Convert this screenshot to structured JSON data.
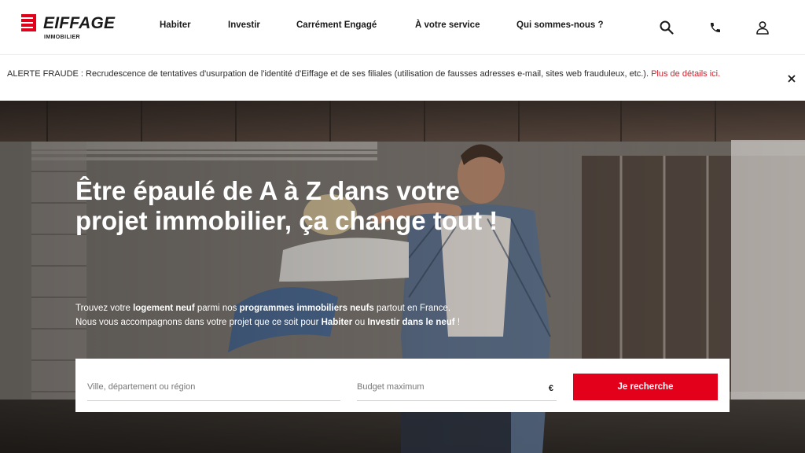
{
  "brand": {
    "name": "EIFFAGE",
    "subtitle": "IMMOBILIER",
    "color": "#e3001b"
  },
  "nav": {
    "items": [
      {
        "label": "Habiter"
      },
      {
        "label": "Investir"
      },
      {
        "label": "Carrément Engagé"
      },
      {
        "label": "À votre service"
      },
      {
        "label": "Qui sommes-nous ?"
      }
    ],
    "icons": [
      "search-icon",
      "phone-icon",
      "user-icon"
    ]
  },
  "alert": {
    "text": "ALERTE FRAUDE : Recrudescence de tentatives d'usurpation de l'identité d'Eiffage et de ses filiales (utilisation de fausses adresses e-mail, sites web frauduleux, etc.). ",
    "link_label": "Plus de détails ici.",
    "close_icon": "close-icon"
  },
  "hero": {
    "title": "Être épaulé de A à Z dans votre projet immobilier, ça change tout !",
    "desc_line1": {
      "p1": "Trouvez votre ",
      "b1": "logement neuf",
      "p2": " parmi nos ",
      "b2": "programmes immobiliers neufs",
      "p3": " partout en France."
    },
    "desc_line2": {
      "p1": "Nous vous accompagnons dans votre projet que ce soit pour ",
      "b1": "Habiter",
      "p2": " ou ",
      "b2": "Investir dans le neuf",
      "p3": " !"
    }
  },
  "search": {
    "location_placeholder": "Ville, département ou région",
    "budget_placeholder": "Budget maximum",
    "currency": "€",
    "button_label": "Je recherche"
  }
}
